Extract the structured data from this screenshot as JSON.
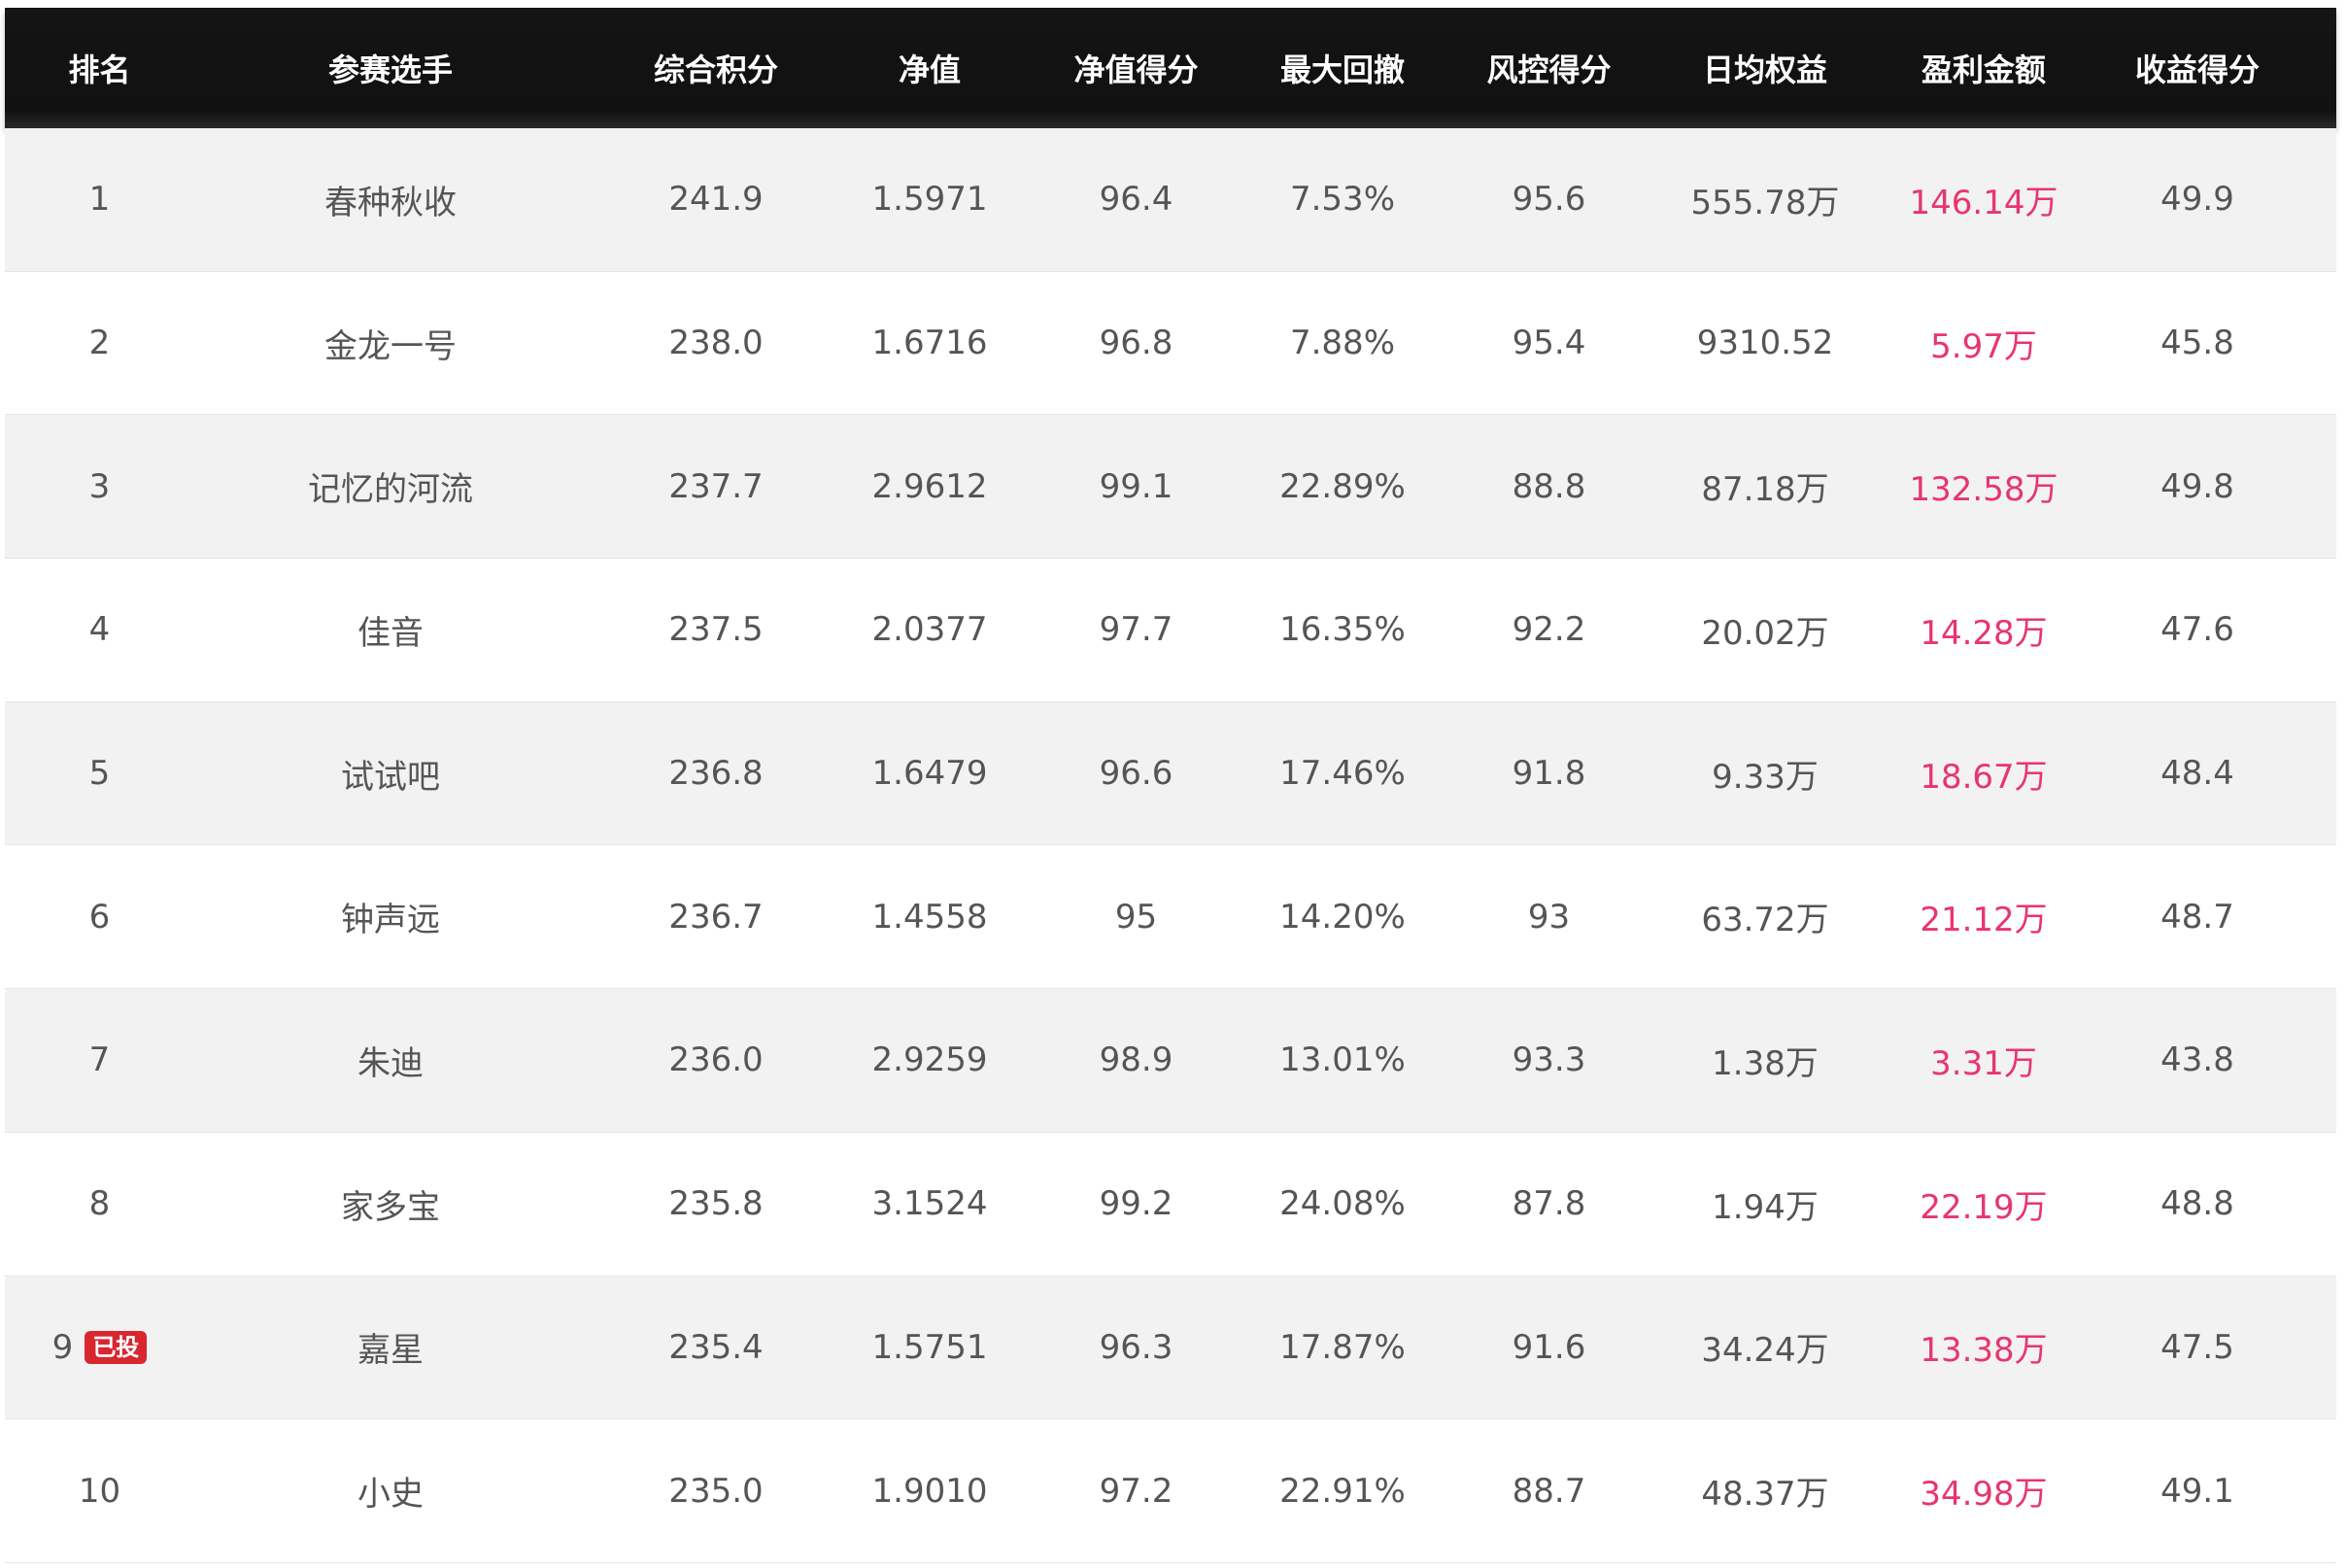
{
  "table": {
    "headers": {
      "rank": "排名",
      "player": "参赛选手",
      "score": "综合积分",
      "nav": "净值",
      "nav_score": "净值得分",
      "max_drawdown": "最大回撤",
      "risk_score": "风控得分",
      "avg_equity": "日均权益",
      "profit": "盈利金额",
      "return_score": "收益得分"
    },
    "rows": [
      {
        "rank": "1",
        "badge": "",
        "player": "春种秋收",
        "score": "241.9",
        "nav": "1.5971",
        "nav_score": "96.4",
        "max_drawdown": "7.53%",
        "risk_score": "95.6",
        "avg_equity": "555.78万",
        "profit": "146.14万",
        "return_score": "49.9"
      },
      {
        "rank": "2",
        "badge": "",
        "player": "金龙一号",
        "score": "238.0",
        "nav": "1.6716",
        "nav_score": "96.8",
        "max_drawdown": "7.88%",
        "risk_score": "95.4",
        "avg_equity": "9310.52",
        "profit": "5.97万",
        "return_score": "45.8"
      },
      {
        "rank": "3",
        "badge": "",
        "player": "记忆的河流",
        "score": "237.7",
        "nav": "2.9612",
        "nav_score": "99.1",
        "max_drawdown": "22.89%",
        "risk_score": "88.8",
        "avg_equity": "87.18万",
        "profit": "132.58万",
        "return_score": "49.8"
      },
      {
        "rank": "4",
        "badge": "",
        "player": "佳音",
        "score": "237.5",
        "nav": "2.0377",
        "nav_score": "97.7",
        "max_drawdown": "16.35%",
        "risk_score": "92.2",
        "avg_equity": "20.02万",
        "profit": "14.28万",
        "return_score": "47.6"
      },
      {
        "rank": "5",
        "badge": "",
        "player": "试试吧",
        "score": "236.8",
        "nav": "1.6479",
        "nav_score": "96.6",
        "max_drawdown": "17.46%",
        "risk_score": "91.8",
        "avg_equity": "9.33万",
        "profit": "18.67万",
        "return_score": "48.4"
      },
      {
        "rank": "6",
        "badge": "",
        "player": "钟声远",
        "score": "236.7",
        "nav": "1.4558",
        "nav_score": "95",
        "max_drawdown": "14.20%",
        "risk_score": "93",
        "avg_equity": "63.72万",
        "profit": "21.12万",
        "return_score": "48.7"
      },
      {
        "rank": "7",
        "badge": "",
        "player": "朱迪",
        "score": "236.0",
        "nav": "2.9259",
        "nav_score": "98.9",
        "max_drawdown": "13.01%",
        "risk_score": "93.3",
        "avg_equity": "1.38万",
        "profit": "3.31万",
        "return_score": "43.8"
      },
      {
        "rank": "8",
        "badge": "",
        "player": "家多宝",
        "score": "235.8",
        "nav": "3.1524",
        "nav_score": "99.2",
        "max_drawdown": "24.08%",
        "risk_score": "87.8",
        "avg_equity": "1.94万",
        "profit": "22.19万",
        "return_score": "48.8"
      },
      {
        "rank": "9",
        "badge": "已投",
        "player": "嘉星",
        "score": "235.4",
        "nav": "1.5751",
        "nav_score": "96.3",
        "max_drawdown": "17.87%",
        "risk_score": "91.6",
        "avg_equity": "34.24万",
        "profit": "13.38万",
        "return_score": "47.5"
      },
      {
        "rank": "10",
        "badge": "",
        "player": "小史",
        "score": "235.0",
        "nav": "1.9010",
        "nav_score": "97.2",
        "max_drawdown": "22.91%",
        "risk_score": "88.7",
        "avg_equity": "48.37万",
        "profit": "34.98万",
        "return_score": "49.1"
      }
    ]
  },
  "colors": {
    "header_bg": "#111111",
    "header_text": "#ffffff",
    "row_odd": "#f2f2f2",
    "row_even": "#ffffff",
    "body_text": "#555555",
    "profit_text": "#e8356d",
    "badge_bg": "#d9262f"
  }
}
